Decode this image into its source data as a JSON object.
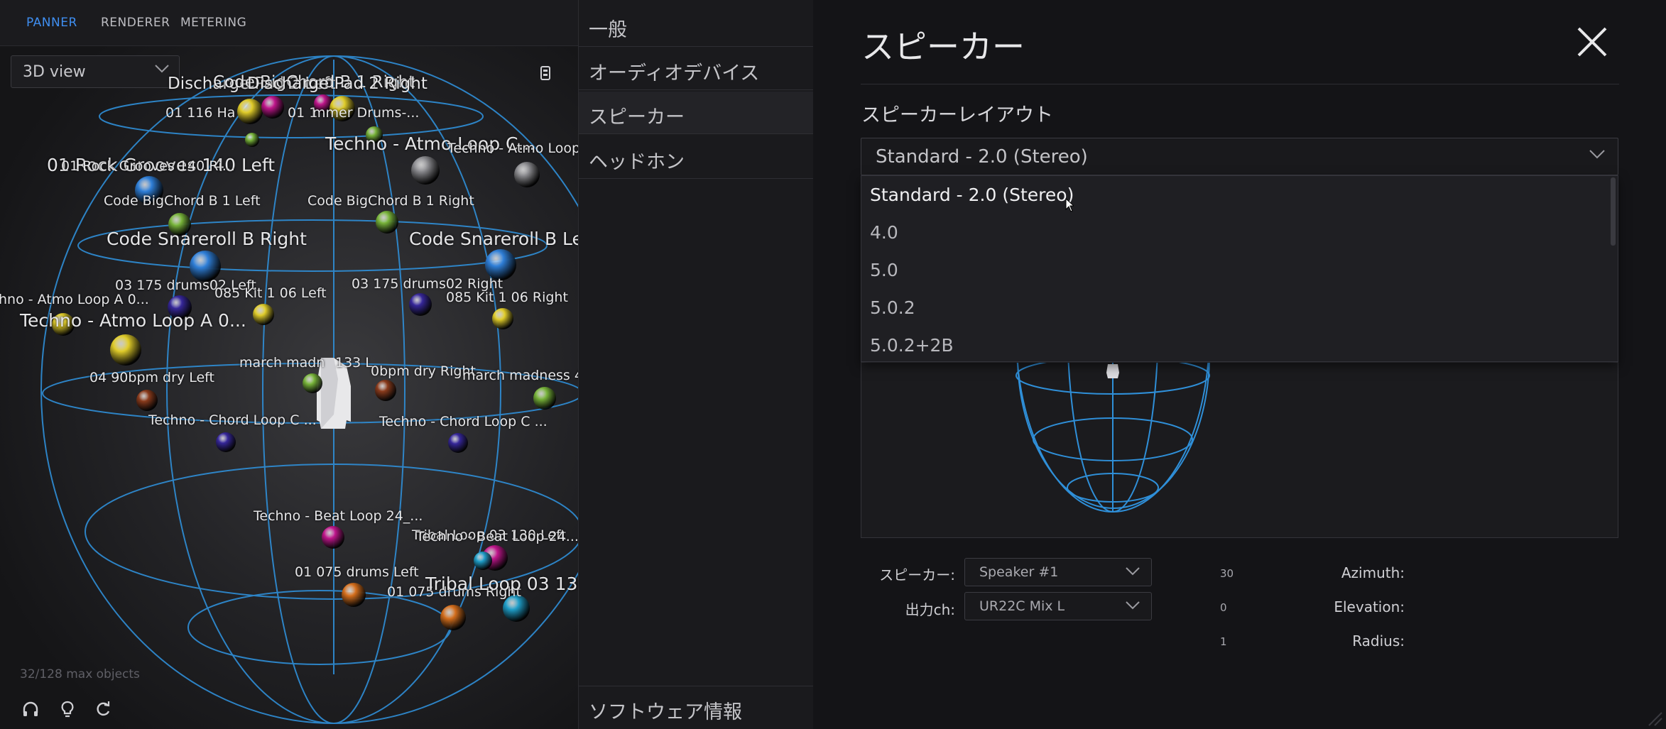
{
  "panner": {
    "tabs": [
      "PANNER",
      "RENDERER",
      "METERING"
    ],
    "view_select": "3D view",
    "object_count": "32/128 max objects",
    "objects": [
      {
        "label": "Discharge Pad 2 Left",
        "size": 23
      },
      {
        "label": "Code BigChord B 1 Right",
        "size": 23
      },
      {
        "label": "Discharge Pad 2 Right",
        "size": 23
      },
      {
        "label": "01 116 Ha",
        "size": 19
      },
      {
        "label": "01 1",
        "size": 19
      },
      {
        "label": "mmer Drums-...",
        "size": 19
      },
      {
        "label": "Techno - Atmo Loop C...",
        "size": 25
      },
      {
        "label": "Techno - Atmo Loop",
        "size": 19
      },
      {
        "label": "01 Rock Grooves 140 Left",
        "size": 25
      },
      {
        "label": "01 Rock Grooves 140 Ri...",
        "size": 19
      },
      {
        "label": "Code BigChord B 1 Left",
        "size": 19
      },
      {
        "label": "Code BigChord B 1 Right",
        "size": 19
      },
      {
        "label": "Code Snareroll B Right",
        "size": 25
      },
      {
        "label": "Code Snareroll B Le",
        "size": 25
      },
      {
        "label": "03 175 drums02 Left",
        "size": 19
      },
      {
        "label": "085 Kit 1 06 Left",
        "size": 19
      },
      {
        "label": "03 175 drums02 Right",
        "size": 19
      },
      {
        "label": "085 Kit 1 06 Right",
        "size": 19
      },
      {
        "label": "hno - Atmo Loop A 0...",
        "size": 19
      },
      {
        "label": "Techno - Atmo Loop A 0...",
        "size": 25
      },
      {
        "label": "march madn",
        "size": 19
      },
      {
        "label": "133 L",
        "size": 19
      },
      {
        "label": "0bpm dry Right",
        "size": 19
      },
      {
        "label": "march madness 4",
        "size": 19
      },
      {
        "label": "04 90bpm dry Left",
        "size": 19
      },
      {
        "label": "Techno - Chord Loop C ...",
        "size": 19
      },
      {
        "label": "Techno - Chord Loop C ...",
        "size": 19
      },
      {
        "label": "Techno - Beat Loop 24_...",
        "size": 19
      },
      {
        "label": "Tribal Loop 03 130 Left",
        "size": 19
      },
      {
        "label": "Techno - Beat Loop 24...",
        "size": 19
      },
      {
        "label": "01 075 drums Left",
        "size": 19
      },
      {
        "label": "01 075 drums Right",
        "size": 19
      },
      {
        "label": "Tribal Loop 03 130 R",
        "size": 25
      }
    ]
  },
  "nav": {
    "items": [
      "一般",
      "オーディオデバイス",
      "スピーカー",
      "ヘッドホン"
    ],
    "footer": "ソフトウェア情報"
  },
  "settings": {
    "title": "スピーカー",
    "layout_label": "スピーカーレイアウト",
    "layout_value": "Standard - 2.0 (Stereo)",
    "options": [
      "Standard - 2.0 (Stereo)",
      "4.0",
      "5.0",
      "5.0.2",
      "5.0.2+2B"
    ],
    "speaker_label": "スピーカー:",
    "speaker_value": "Speaker #1",
    "output_label": "出力ch:",
    "output_value": "UR22C Mix L",
    "azimuth_label": "Azimuth:",
    "azimuth_value": "30",
    "elevation_label": "Elevation:",
    "elevation_value": "0",
    "radius_label": "Radius:",
    "radius_value": "1"
  },
  "colors": {
    "accent": "#3f8ef0",
    "wire": "#2f8fd8",
    "yellow": "#e0cc2a",
    "magenta": "#c0168c",
    "green": "#78b43a",
    "blue": "#2f7fd8",
    "navy": "#36279a",
    "orange": "#d46e1c",
    "brown": "#8a3b1c",
    "grey": "#8a8a8e",
    "cyan": "#1f9ec8"
  },
  "icons": {
    "view_chevron": "chevron-down-icon",
    "close": "close-icon",
    "headphones": "headphones-icon",
    "bulb": "bulb-icon",
    "reset": "refresh-icon"
  }
}
